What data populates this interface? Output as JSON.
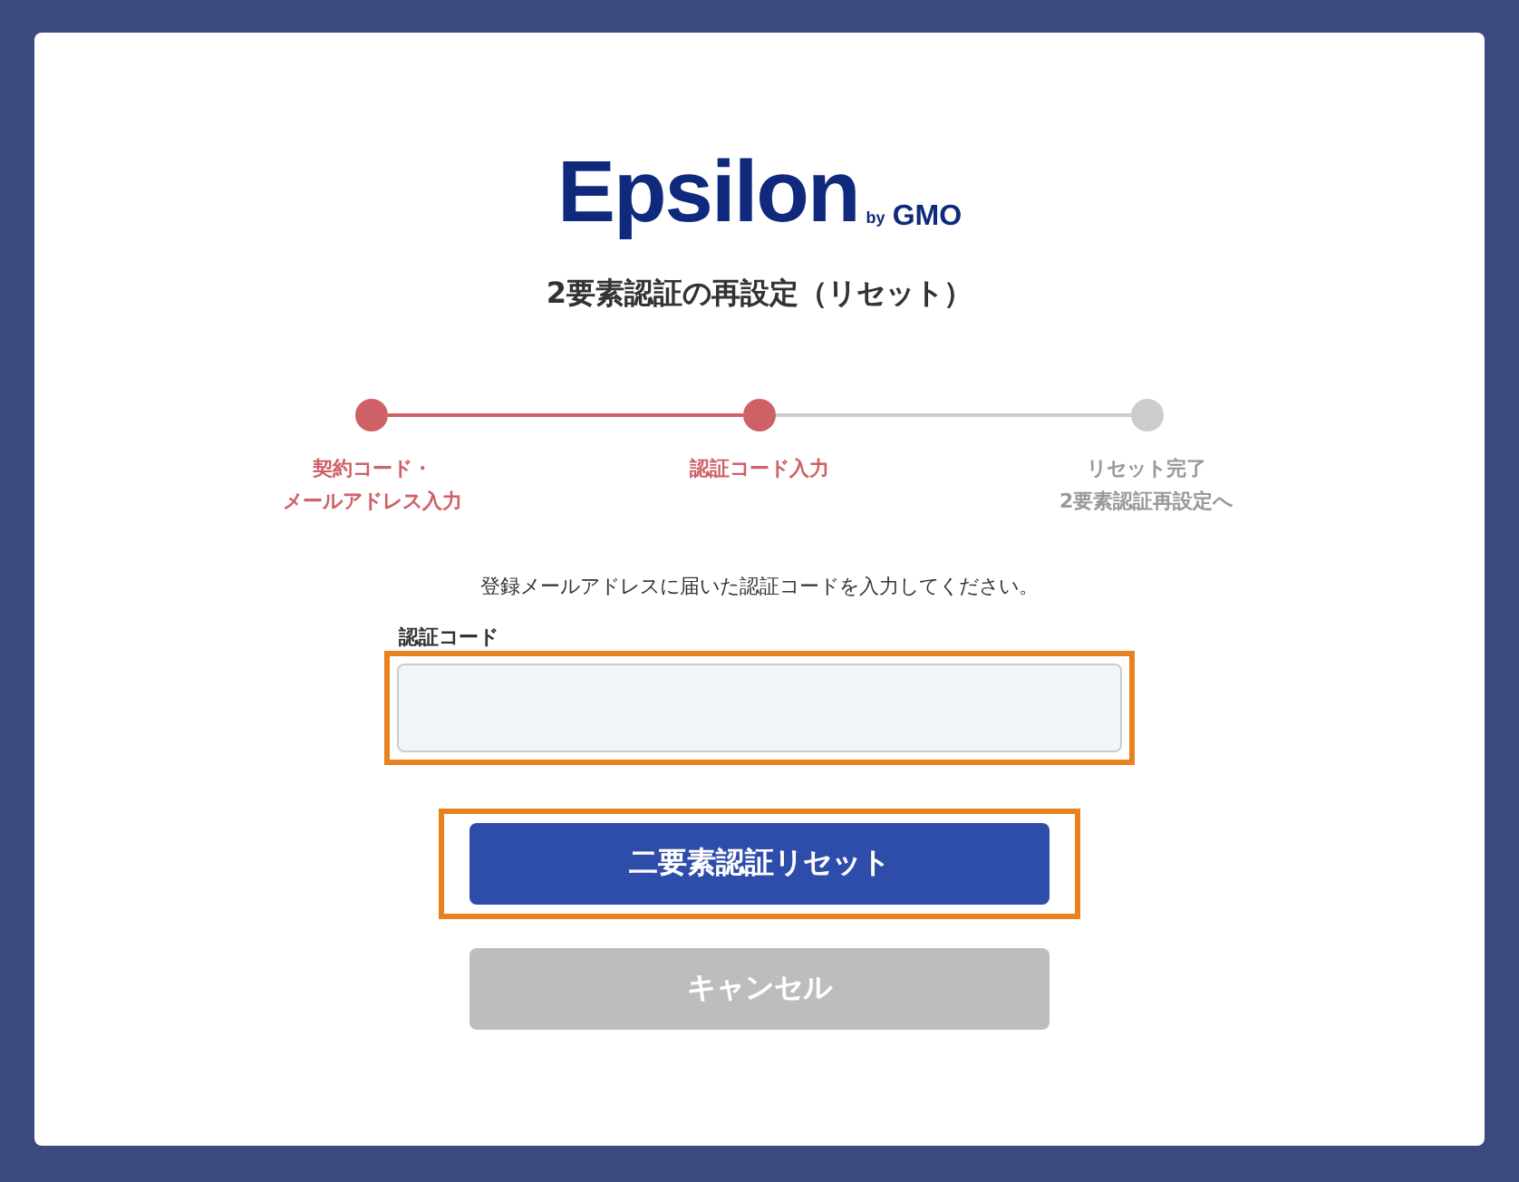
{
  "logo": {
    "name": "Epsilon",
    "suffix": "by",
    "brand": "GMO"
  },
  "title": "2要素認証の再設定（リセット）",
  "steps": [
    {
      "lines": [
        "契約コード・",
        "メールアドレス入力"
      ],
      "completed": true
    },
    {
      "lines": [
        "認証コード入力"
      ],
      "completed": true
    },
    {
      "lines": [
        "リセット完了",
        "2要素認証再設定へ"
      ],
      "completed": false
    }
  ],
  "instruction": "登録メールアドレスに届いた認証コードを入力してください。",
  "field": {
    "label": "認証コード",
    "highlighted": true
  },
  "buttons": [
    {
      "label": "二要素認証リセット",
      "kind": "primary",
      "highlighted": true
    },
    {
      "label": "キャンセル",
      "kind": "disabled",
      "highlighted": false
    }
  ]
}
